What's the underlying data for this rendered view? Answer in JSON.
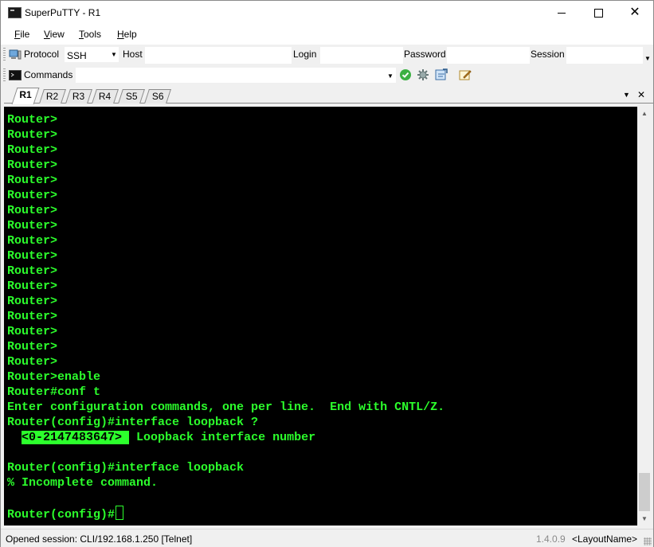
{
  "window": {
    "title": "SuperPuTTY - R1"
  },
  "menu": {
    "items": [
      {
        "label": "File",
        "accel": "F",
        "rest": "ile"
      },
      {
        "label": "View",
        "accel": "V",
        "rest": "iew"
      },
      {
        "label": "Tools",
        "accel": "T",
        "rest": "ools"
      },
      {
        "label": "Help",
        "accel": "H",
        "rest": "elp"
      }
    ]
  },
  "toolbar": {
    "protocol_label": "Protocol",
    "protocol_value": "SSH",
    "host_label": "Host",
    "host_value": "",
    "login_label": "Login",
    "login_value": "",
    "password_label": "Password",
    "password_value": "",
    "session_label": "Session",
    "session_value": "",
    "commands_label": "Commands",
    "commands_value": ""
  },
  "tabs": [
    {
      "label": "R1",
      "active": true
    },
    {
      "label": "R2",
      "active": false
    },
    {
      "label": "R3",
      "active": false
    },
    {
      "label": "R4",
      "active": false
    },
    {
      "label": "S5",
      "active": false
    },
    {
      "label": "S6",
      "active": false
    }
  ],
  "tab_controls": {
    "scroll_down": "▼",
    "close": "✕"
  },
  "terminal": {
    "lines": [
      "Router>",
      "Router>",
      "Router>",
      "Router>",
      "Router>",
      "Router>",
      "Router>",
      "Router>",
      "Router>",
      "Router>",
      "Router>",
      "Router>",
      "Router>",
      "Router>",
      "Router>",
      "Router>",
      "Router>",
      "Router>enable",
      "Router#conf t",
      "Enter configuration commands, one per line.  End with CNTL/Z.",
      "Router(config)#interface loopback ?",
      "",
      "",
      "Router(config)#interface loopback",
      "% Incomplete command.",
      ""
    ],
    "help_indent": "  ",
    "help_highlight": "<0-2147483647> ",
    "help_text": " Loopback interface number",
    "prompt": "Router(config)#"
  },
  "status": {
    "session_text": "Opened session: CLI/192.168.1.250 [Telnet]",
    "version": "1.4.0.9",
    "layout": "<LayoutName>"
  },
  "colors": {
    "terminal_fg": "#2cff2c",
    "terminal_bg": "#000000"
  }
}
